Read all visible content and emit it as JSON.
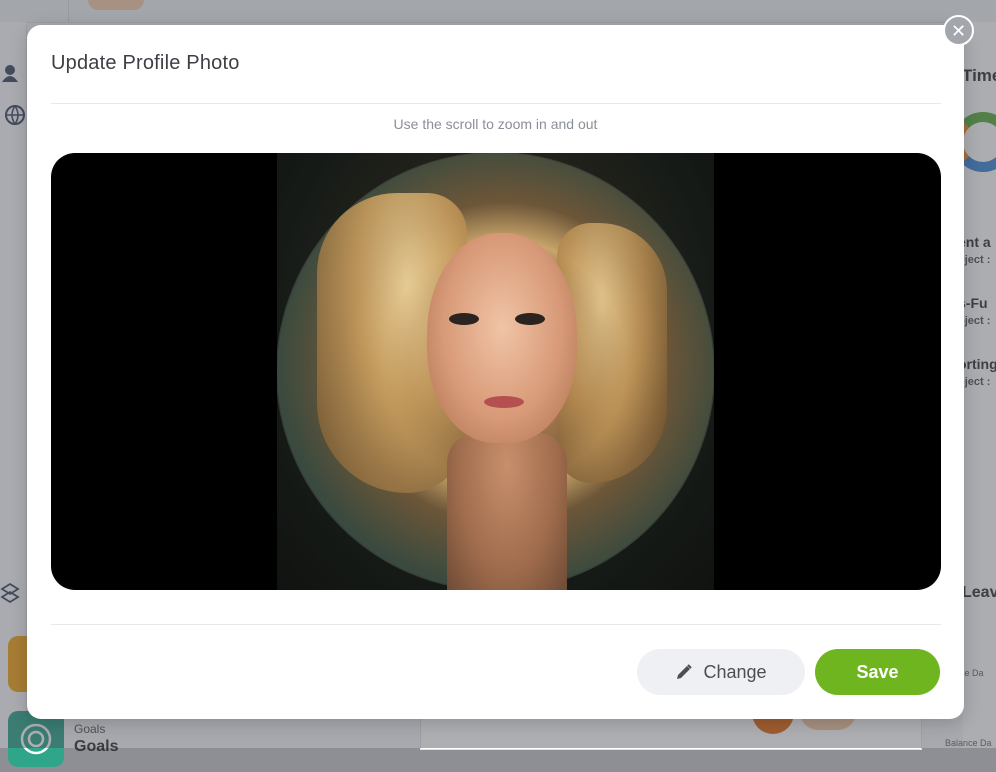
{
  "background": {
    "right_panel": {
      "heading_time": "Time",
      "items": [
        {
          "title": "ent a",
          "sub": "oject :"
        },
        {
          "title": "s-Fu",
          "sub": "oject :"
        },
        {
          "title": "orting",
          "sub": "oject :"
        }
      ],
      "heading_leave": "Leav",
      "balance_labels": [
        "lance Da",
        "Balance Da"
      ]
    },
    "goals": {
      "label": "Goals",
      "title": "Goals"
    }
  },
  "modal": {
    "title": "Update Profile Photo",
    "hint": "Use the scroll to zoom in and out",
    "change_label": "Change",
    "save_label": "Save",
    "close_glyph": "✕"
  },
  "colors": {
    "save": "#6eb51f",
    "change_bg": "#eef0f3",
    "overlay": "rgba(75,78,86,0.45)",
    "crop_bg": "#000000"
  },
  "icons": {
    "close": "close-icon",
    "change": "pencil-icon"
  }
}
